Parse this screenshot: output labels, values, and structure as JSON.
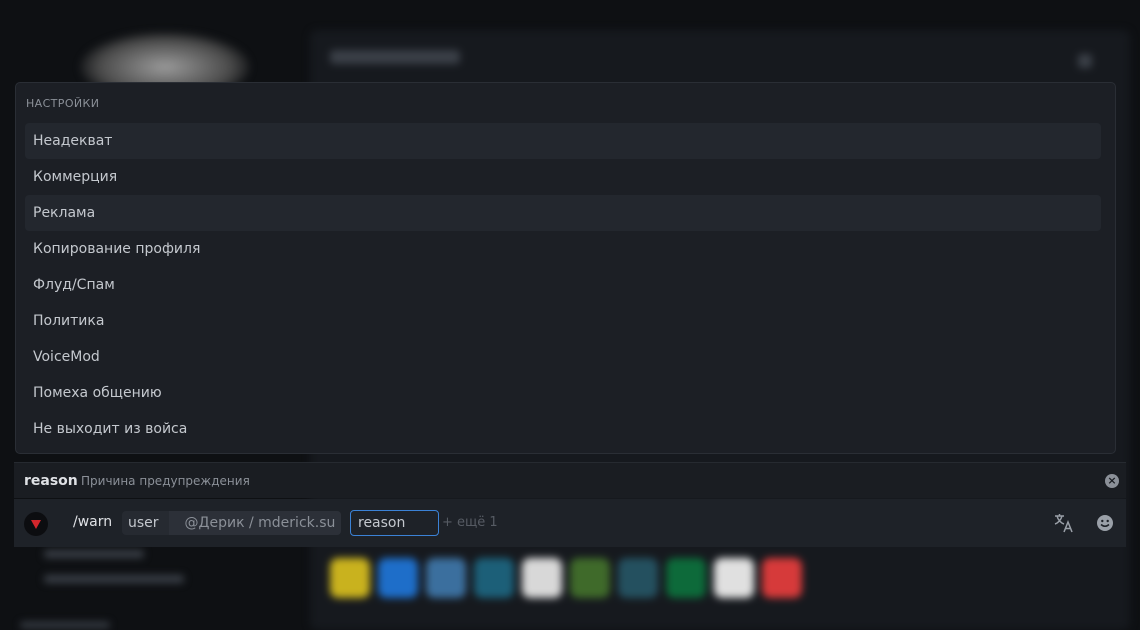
{
  "dropdown": {
    "title": "НАСТРОЙКИ",
    "items": [
      "Неадекват",
      "Коммерция",
      "Реклама",
      "Копирование профиля",
      "Флуд/Спам",
      "Политика",
      "VoiceMod",
      "Помеха общению",
      "Не выходит из войса"
    ]
  },
  "argument": {
    "name": "reason",
    "description": "Причина предупреждения"
  },
  "input": {
    "command": "/warn",
    "user_option": "user",
    "user_value": "@Дерик / mderick.su",
    "reason_option": "reason",
    "more": "+ ещё 1"
  },
  "icons": {
    "app": "bot-avatar-icon",
    "close": "clear-circle-icon",
    "translate": "translate-icon",
    "emoji": "emoji-icon"
  },
  "colors": {
    "accent": "#3b82d6",
    "app_icon": "#d3262c"
  }
}
